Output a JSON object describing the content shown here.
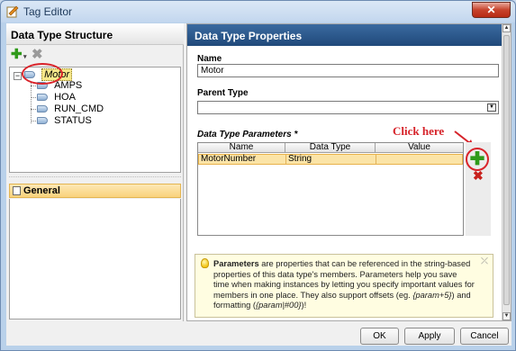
{
  "window": {
    "title": "Tag Editor",
    "close_glyph": "✕"
  },
  "left": {
    "header": "Data Type Structure",
    "toolbar": {
      "add_icon": "green-plus-icon",
      "delete_icon": "gray-x-icon"
    },
    "tree": {
      "root": "Motor",
      "children": [
        "AMPS",
        "HOA",
        "RUN_CMD",
        "STATUS"
      ]
    },
    "section_item": "General"
  },
  "right": {
    "header": "Data Type Properties",
    "name_label": "Name",
    "name_value": "Motor",
    "parent_type_label": "Parent Type",
    "parent_type_value": "",
    "params_label": "Data Type Parameters *",
    "params_columns": [
      "Name",
      "Data Type",
      "Value"
    ],
    "params_rows": [
      {
        "name": "MotorNumber",
        "data_type": "String",
        "value": ""
      }
    ],
    "annotation": "Click here",
    "help": {
      "lead": "Parameters",
      "text1": " are properties that can be referenced in the string-based properties of this data type's members. Parameters help you save time when making instances by letting you specify important values for members in one place. They also support offsets (eg. ",
      "ex1": "{param+5}",
      "text2": ") and formatting (",
      "ex2": "{param|#00}",
      "text3": ")!"
    }
  },
  "buttons": {
    "ok": "OK",
    "apply": "Apply",
    "cancel": "Cancel"
  },
  "colors": {
    "accent_header": "#20497a",
    "annotation": "#d6232a",
    "selection": "#fbe4a7"
  }
}
